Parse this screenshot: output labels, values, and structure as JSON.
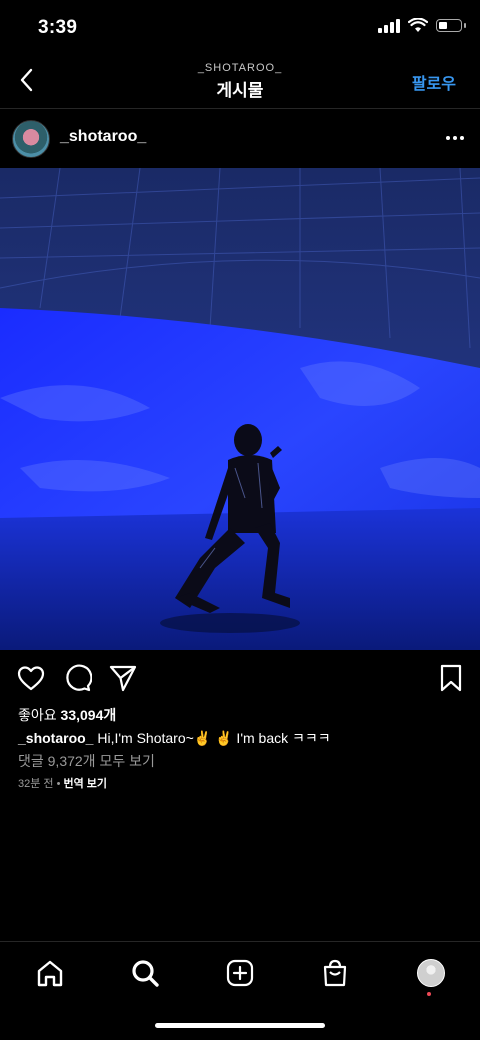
{
  "status": {
    "time": "3:39"
  },
  "header": {
    "username": "_SHOTAROO_",
    "title": "게시물",
    "follow_label": "팔로우"
  },
  "post": {
    "username": "_shotaroo_",
    "likes_prefix": "좋아요",
    "likes_count": "33,094개",
    "caption_user": "_shotaroo_",
    "caption_text": " Hi,I'm Shotaro~✌️ ✌️ I'm back ㅋㅋㅋ",
    "comments_link": "댓글 9,372개 모두 보기",
    "timestamp": "32분 전",
    "separator": " • ",
    "translate_label": "번역 보기"
  },
  "colors": {
    "accent": "#3897f0",
    "background": "#000000",
    "notification": "#ed4956"
  },
  "icons": {
    "back": "chevron-left-icon",
    "more": "more-horizontal-icon",
    "like": "heart-icon",
    "comment": "comment-icon",
    "share": "send-icon",
    "save": "bookmark-icon",
    "home": "home-icon",
    "search": "search-icon",
    "create": "plus-square-icon",
    "shop": "shopping-bag-icon"
  }
}
